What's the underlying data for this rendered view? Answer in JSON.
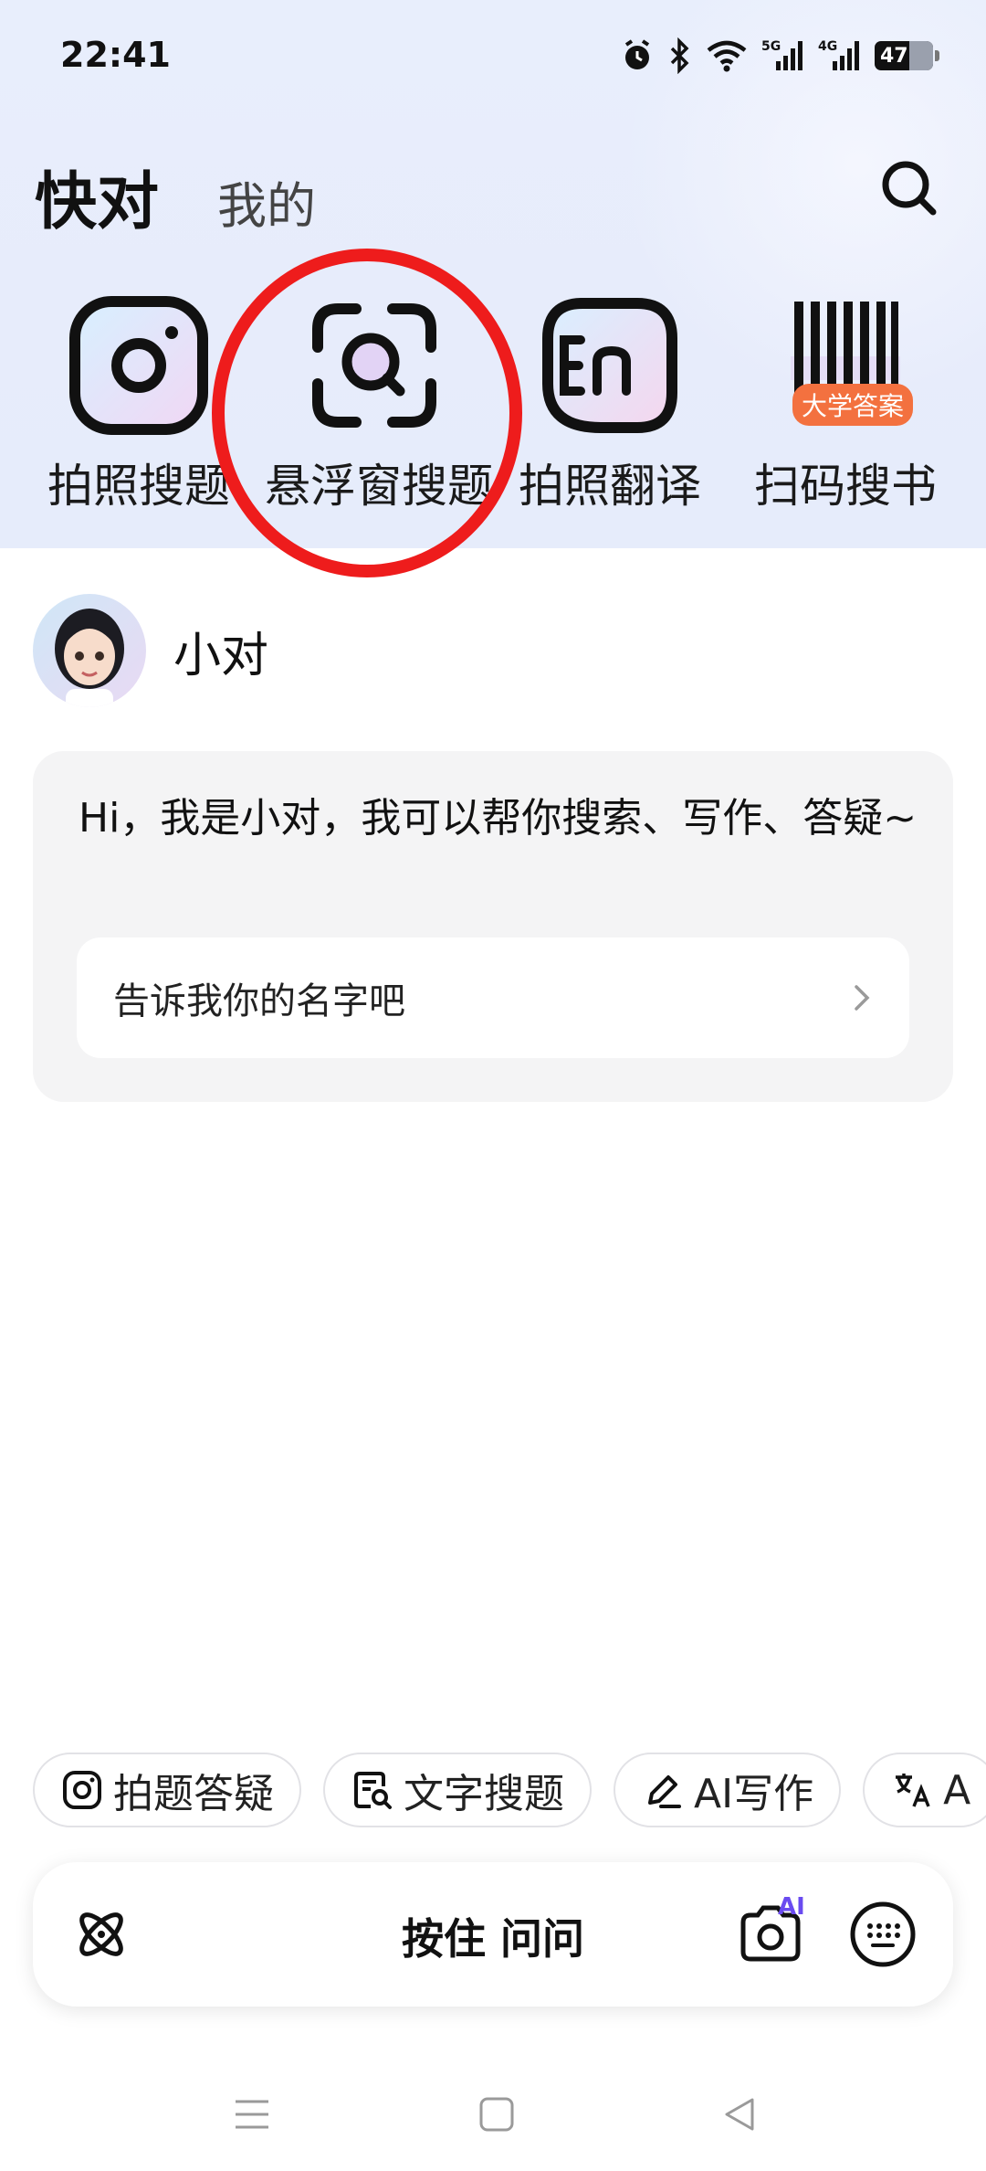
{
  "status_bar": {
    "time": "22:41",
    "battery": "47"
  },
  "nav": {
    "active_tab": "快对",
    "other_tab": "我的"
  },
  "tools": [
    {
      "label": "拍照搜题",
      "icon": "camera-icon"
    },
    {
      "label": "悬浮窗搜题",
      "icon": "scan-search-icon"
    },
    {
      "label": "拍照翻译",
      "icon": "translate-en-icon"
    },
    {
      "label": "扫码搜书",
      "icon": "barcode-icon",
      "badge": "大学答案"
    }
  ],
  "assistant": {
    "name": "小对",
    "greeting": "Hi，我是小对，我可以帮你搜索、写作、答疑~",
    "prompt": "告诉我你的名字吧"
  },
  "chips": [
    {
      "label": "拍题答疑",
      "icon": "camera-icon"
    },
    {
      "label": "文字搜题",
      "icon": "text-search-icon"
    },
    {
      "label": "AI写作",
      "icon": "pen-icon"
    },
    {
      "label": "A",
      "icon": "translate-icon"
    }
  ],
  "input_bar": {
    "hold_label": "按住 问问",
    "ai_badge": "AI"
  },
  "colors": {
    "highlight_circle": "#ee1c1c",
    "badge": "#f3713f",
    "hero_bg": "#e7ecfb"
  }
}
